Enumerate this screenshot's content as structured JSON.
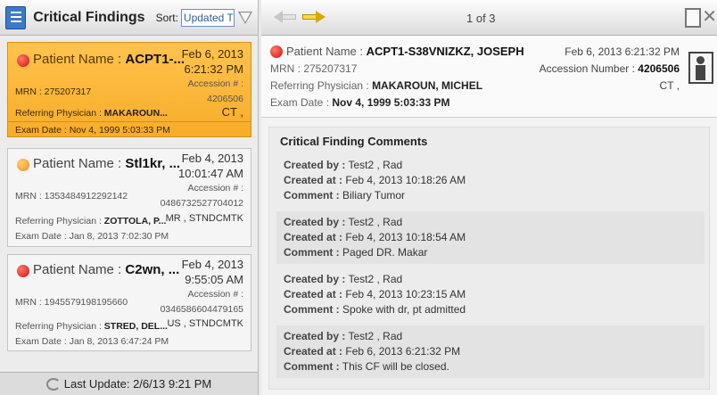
{
  "left": {
    "title": "Critical Findings",
    "sort_label": "Sort:",
    "sort_value": "Updated T",
    "footer": "Last Update: 2/6/13 9:21 PM"
  },
  "cards": [
    {
      "status_color": "red",
      "name_label": "Patient Name :",
      "name": "ACPT1-...",
      "date": "Feb 6, 2013",
      "time": "6:21:32 PM",
      "accession_label": "Accession # :",
      "accession": "4206506",
      "mrn": "MRN :  275207317",
      "referring_label": "Referring Physician :",
      "referring": "MAKAROUN...",
      "modality": "CT ,",
      "exam_date": "Exam Date :  Nov 4, 1999 5:03:33 PM"
    },
    {
      "status_color": "orange",
      "name_label": "Patient Name :",
      "name": "Stl1kr, ...",
      "date": "Feb 4, 2013",
      "time": "10:01:47 AM",
      "accession_label": "Accession # :",
      "accession": "0486732527704012",
      "mrn": "MRN :  1353484912292142",
      "referring_label": "Referring Physician :",
      "referring": "ZOTTOLA, P...",
      "modality": "MR , STNDCMTK",
      "exam_date": "Exam Date :  Jan 8, 2013 7:02:30 PM"
    },
    {
      "status_color": "red",
      "name_label": "Patient Name :",
      "name": "C2wn, ...",
      "date": "Feb 4, 2013",
      "time": "9:55:05 AM",
      "accession_label": "Accession # :",
      "accession": "0346586604479165",
      "mrn": "MRN :  1945579198195660",
      "referring_label": "Referring Physician :",
      "referring": "STRED, DEL...",
      "modality": "US , STNDCMTK",
      "exam_date": "Exam Date :  Jan 8, 2013 6:47:24 PM"
    }
  ],
  "right": {
    "pager": "1 of 3",
    "patient": {
      "name_label": "Patient Name :",
      "name": "ACPT1-S38VNIZKZ, JOSEPH",
      "mrn": "MRN :  275207317",
      "referring_label": "Referring Physician :",
      "referring": "MAKAROUN, MICHEL",
      "exam_date_label": "Exam Date :",
      "exam_date": "Nov 4, 1999 5:03:33 PM",
      "datetime": "Feb 6, 2013 6:21:32 PM",
      "accession_label": "Accession Number :",
      "accession": "4206506",
      "modality": "CT ,"
    },
    "comments_title": "Critical Finding Comments",
    "comments": [
      {
        "created_by": "Test2 , Rad",
        "created_at": "Feb 4, 2013 10:18:26 AM",
        "comment": "Biliary Tumor"
      },
      {
        "created_by": "Test2 , Rad",
        "created_at": "Feb 4, 2013 10:18:54 AM",
        "comment": "Paged DR. Makar"
      },
      {
        "created_by": "Test2 , Rad",
        "created_at": "Feb 4, 2013 10:23:15 AM",
        "comment": "Spoke with dr, pt admitted"
      },
      {
        "created_by": "Test2 , Rad",
        "created_at": "Feb 6, 2013 6:21:32 PM",
        "comment": "This CF will be closed."
      }
    ],
    "labels": {
      "created_by": "Created by :",
      "created_at": "Created at :",
      "comment": "Comment :"
    }
  }
}
